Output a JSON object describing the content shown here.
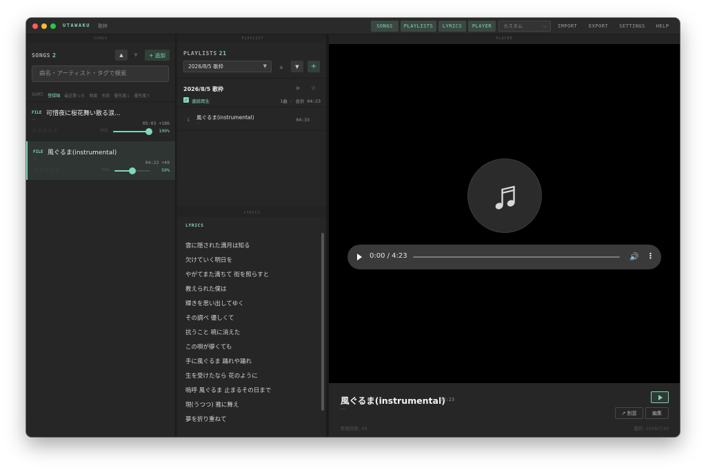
{
  "app": {
    "name": "UTAWAKU",
    "subtitle": "歌枠",
    "nav": [
      "SONGS",
      "PLAYLISTS",
      "LYRICS",
      "PLAYER"
    ],
    "preset": "カスタム",
    "menu": [
      "IMPORT",
      "EXPORT",
      "SETTINGS",
      "HELP"
    ]
  },
  "panel_headers": {
    "songs": "SONGS",
    "playlist": "PLAYLIST",
    "player": "PLAYER",
    "lyrics": "LYRICS"
  },
  "songs": {
    "label": "SONGS",
    "count": "2",
    "add_label": "+ 追加",
    "up_icon": "▲",
    "down_icon": "▼",
    "search_placeholder": "曲名・アーティスト・タグで検索",
    "sort_label": "SORT:",
    "sort_options": [
      "登録順",
      "最近歌った",
      "頻度",
      "名前",
      "優先度↓",
      "優先度↑"
    ],
    "items": [
      {
        "tag": "FILE",
        "title": "可惜夜に桜花舞い散る涙...",
        "artist": "—",
        "duration": "05:03",
        "plays": "+186",
        "stars": "☆☆☆☆☆",
        "vol_label": "VOL",
        "volume_pct": 100,
        "volume_text": "100%"
      },
      {
        "tag": "FILE",
        "title": "風ぐるま(instrumental)",
        "artist": "—",
        "duration": "04:23",
        "plays": "+49",
        "stars": "☆☆☆☆☆",
        "vol_label": "VOL",
        "volume_pct": 50,
        "volume_text": "50%"
      }
    ]
  },
  "playlists": {
    "label": "PLAYLISTS",
    "count": "21",
    "selected": "2026/8/5 歌枠",
    "up_icon": "▲",
    "down_icon": "▼",
    "add_icon": "+",
    "current": {
      "name": "2026/8/5 歌枠",
      "continuous_label": "連続再生",
      "summary": "1曲 · 合計 04:23",
      "items": [
        {
          "num": "1",
          "title": "風ぐるま(instrumental)",
          "sub": "—",
          "duration": "04:33"
        }
      ]
    }
  },
  "lyrics": {
    "label": "LYRICS",
    "lines": [
      "雲に隠された満月は知る",
      "欠けていく明日を",
      "やがてまた満ちて 街を照らすと",
      "教えられた僕は",
      "輝きを思い出してゆく",
      "その調べ 優しくて",
      "抗うこと 暁に消えた",
      "この唄が儚くても",
      "手に風ぐるま 踊れや踊れ",
      "生を受けたなら 花のように",
      "嗚呼 風ぐるま 止まるその日まで",
      "現(うつつ) 雅に舞え",
      "夢を折り重ねて"
    ]
  },
  "player": {
    "music_icon": "♫",
    "time": "0:00 / 4:23",
    "progress": 0,
    "volume_icon": "🔊",
    "more_icon": "⋮",
    "now_playing": {
      "title": "風ぐるま(instrumental)",
      "duration": "04:23",
      "artist": "—",
      "popout_label": "↗ 別窓",
      "edit_label": "編集",
      "play_count_label": "歌唱回数: 49",
      "last_label": "最終: 2026/7/30"
    }
  },
  "colors": {
    "accent": "#7fd8b6",
    "bg": "#232323",
    "panel": "#262626",
    "close": "#ff5f57",
    "minimize": "#febc2e",
    "maximize": "#28c840"
  }
}
